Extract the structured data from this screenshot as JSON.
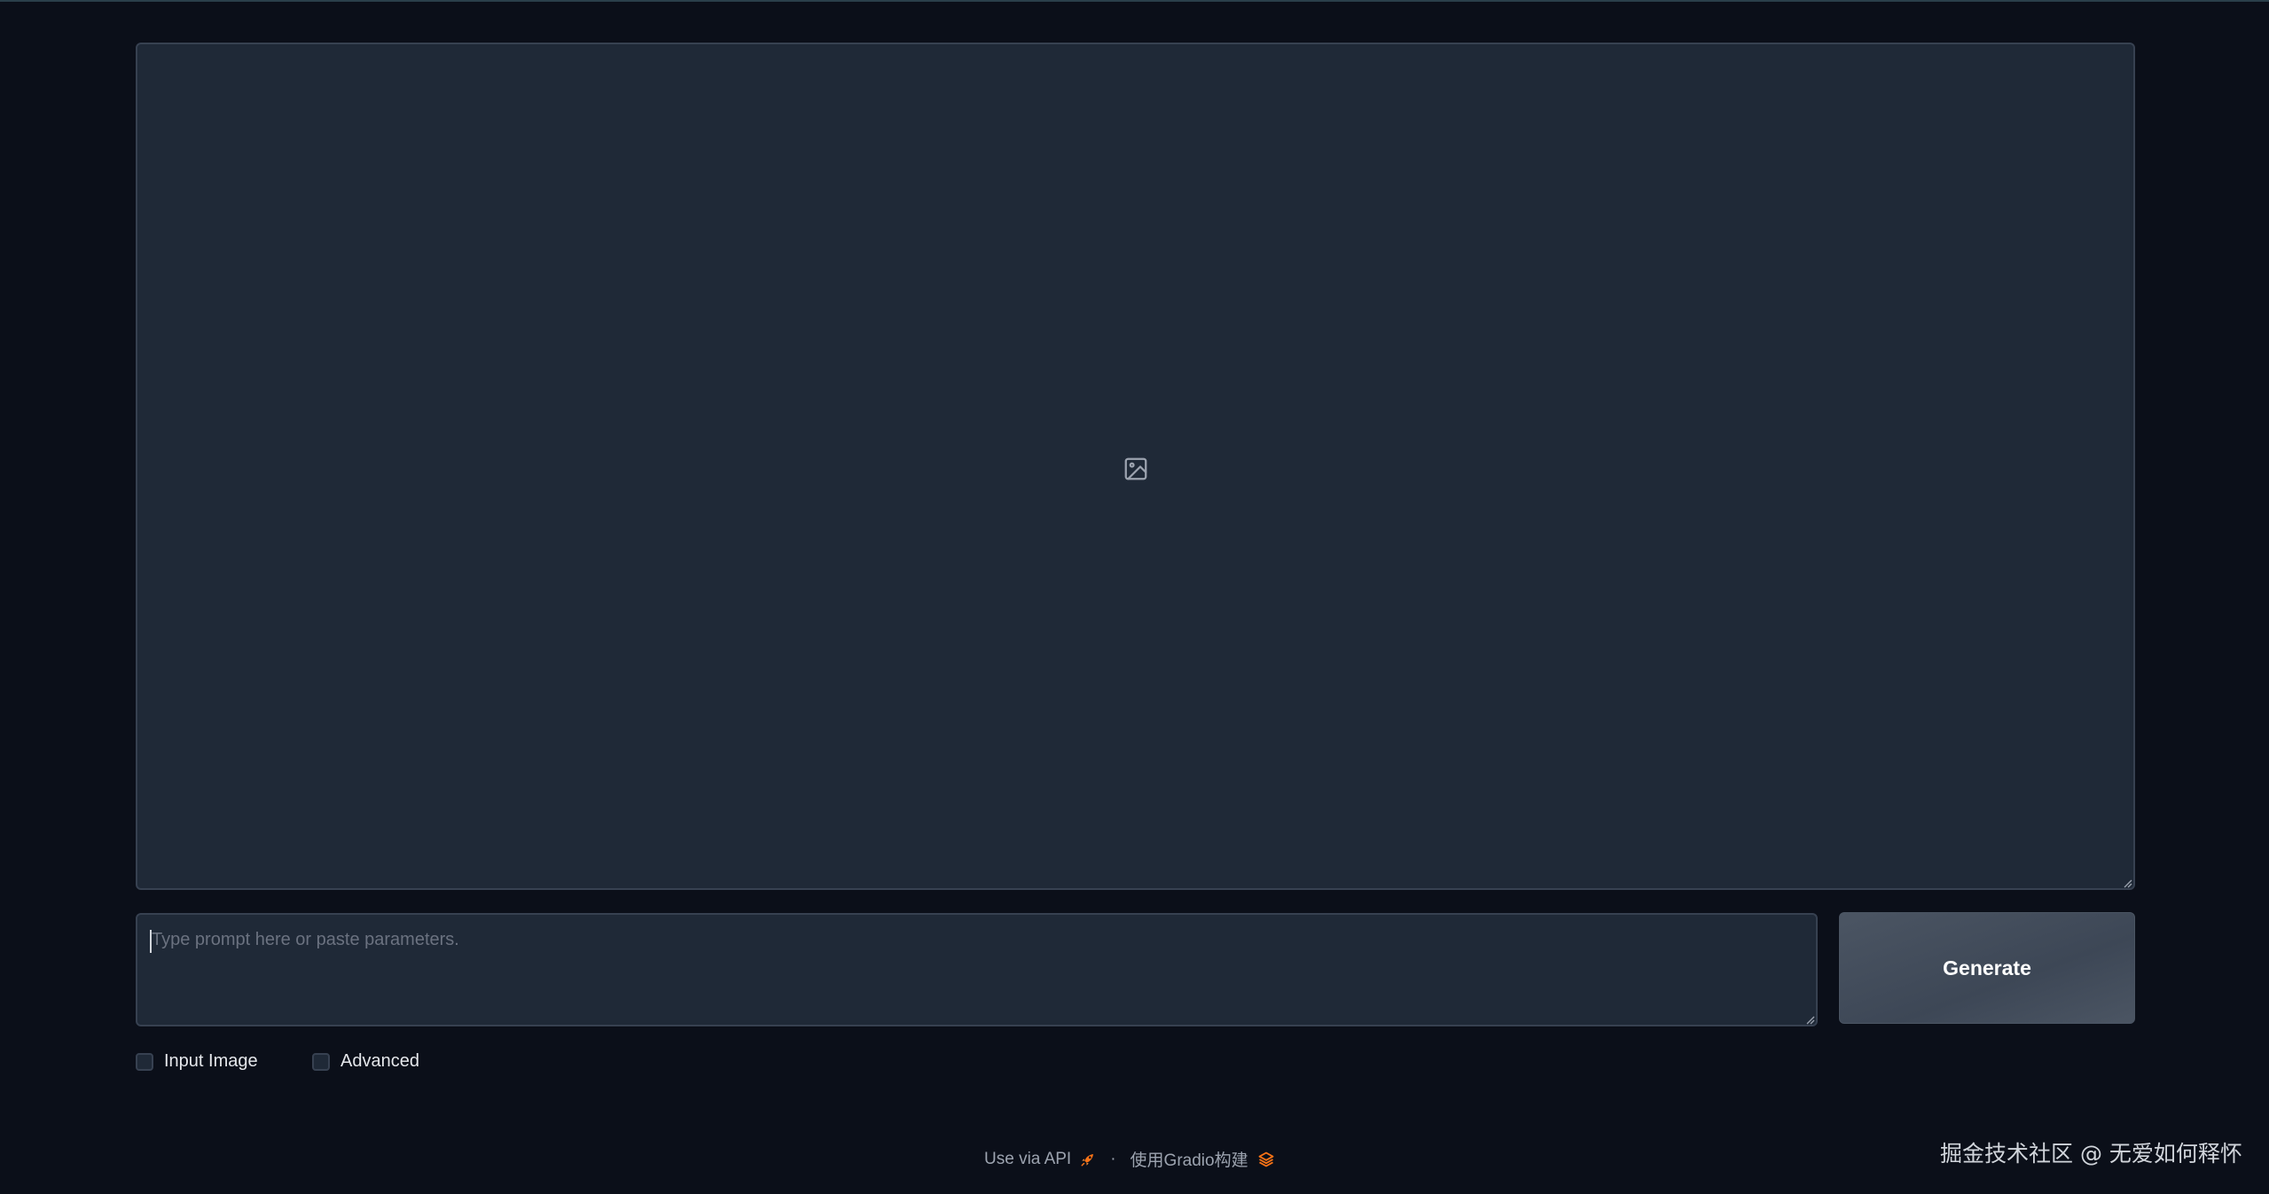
{
  "prompt": {
    "placeholder": "Type prompt here or paste parameters.",
    "value": ""
  },
  "generate_button": {
    "label": "Generate"
  },
  "options": {
    "input_image_label": "Input Image",
    "advanced_label": "Advanced"
  },
  "footer": {
    "api_link": "Use via API",
    "separator": "·",
    "built_with": "使用Gradio构建"
  },
  "watermark": "掘金技术社区 @ 无爱如何释怀",
  "colors": {
    "background": "#0b0f19",
    "panel": "#1f2937",
    "border": "#374151",
    "button": "#4b5563",
    "accent": "#f97316"
  },
  "icons": {
    "image_placeholder": "image-icon",
    "api": "rocket-icon",
    "gradio": "gradio-logo-icon"
  }
}
